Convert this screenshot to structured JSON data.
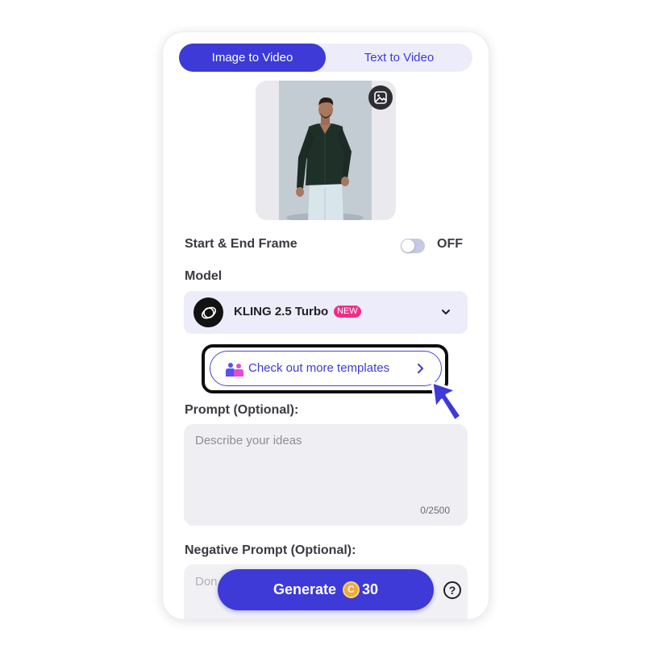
{
  "tabs": [
    {
      "label": "Image to Video",
      "active": true
    },
    {
      "label": "Text to Video",
      "active": false
    }
  ],
  "preview": {
    "edit_icon": "image-edit-icon"
  },
  "start_end_frame": {
    "label": "Start & End Frame",
    "toggle_state": "OFF"
  },
  "model": {
    "section_label": "Model",
    "name": "KLING 2.5 Turbo",
    "badge": "NEW",
    "chevron_icon": "chevron-down-icon"
  },
  "templates": {
    "label": "Check out more templates",
    "icon": "templates-icon",
    "arrow_icon": "chevron-right-icon"
  },
  "prompt": {
    "label": "Prompt (Optional):",
    "placeholder": "Describe your ideas",
    "value": "",
    "counter": "0/2500"
  },
  "negative_prompt": {
    "label": "Negative Prompt (Optional):",
    "placeholder": "Don"
  },
  "generate": {
    "label": "Generate",
    "cost": "30",
    "coin_symbol": "C"
  },
  "help": {
    "symbol": "?"
  },
  "colors": {
    "accent": "#3d3ad8",
    "badge": "#ee2d8a",
    "coin": "#f2a93b",
    "toggle_off": "#c6c9e4"
  }
}
